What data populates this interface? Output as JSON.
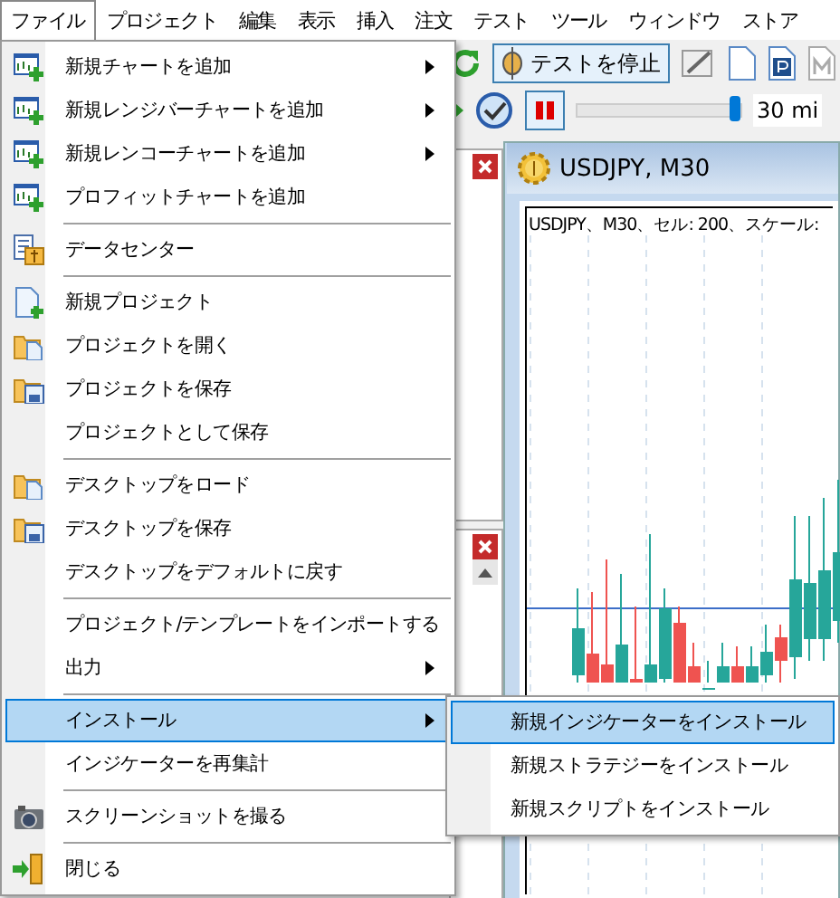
{
  "menubar": [
    {
      "label": "ファイル",
      "selected": true
    },
    {
      "label": "プロジェクト",
      "selected": false
    },
    {
      "label": "編集",
      "selected": false
    },
    {
      "label": "表示",
      "selected": false
    },
    {
      "label": "挿入",
      "selected": false
    },
    {
      "label": "注文",
      "selected": false
    },
    {
      "label": "テスト",
      "selected": false
    },
    {
      "label": "ツール",
      "selected": false
    },
    {
      "label": "ウィンドウ",
      "selected": false
    },
    {
      "label": "ストア",
      "selected": false
    }
  ],
  "toolbar": {
    "stop_test_button": "テストを停止",
    "speed_slider": {
      "level": 0.97
    },
    "speed_label": "30 mi"
  },
  "chart_window": {
    "title": "USDJPY, M30",
    "header": "USDJPY、M30、セル: 200、スケール:"
  },
  "file_menu": [
    {
      "kind": "item",
      "label": "新規チャートを追加",
      "submenu": true,
      "selected": false
    },
    {
      "kind": "item",
      "label": "新規レンジバーチャートを追加",
      "submenu": true,
      "selected": false
    },
    {
      "kind": "item",
      "label": "新規レンコーチャートを追加",
      "submenu": true,
      "selected": false
    },
    {
      "kind": "item",
      "label": "プロフィットチャートを追加",
      "submenu": false,
      "selected": false
    },
    {
      "kind": "separator"
    },
    {
      "kind": "item",
      "label": "データセンター",
      "submenu": false,
      "selected": false
    },
    {
      "kind": "separator"
    },
    {
      "kind": "item",
      "label": "新規プロジェクト",
      "submenu": false,
      "selected": false
    },
    {
      "kind": "item",
      "label": "プロジェクトを開く",
      "submenu": false,
      "selected": false
    },
    {
      "kind": "item",
      "label": "プロジェクトを保存",
      "submenu": false,
      "selected": false
    },
    {
      "kind": "item",
      "label": "プロジェクトとして保存",
      "submenu": false,
      "selected": false
    },
    {
      "kind": "separator"
    },
    {
      "kind": "item",
      "label": "デスクトップをロード",
      "submenu": false,
      "selected": false
    },
    {
      "kind": "item",
      "label": "デスクトップを保存",
      "submenu": false,
      "selected": false
    },
    {
      "kind": "item",
      "label": "デスクトップをデフォルトに戻す",
      "submenu": false,
      "selected": false
    },
    {
      "kind": "separator"
    },
    {
      "kind": "item",
      "label": "プロジェクト/テンプレートをインポートする",
      "submenu": false,
      "selected": false
    },
    {
      "kind": "item",
      "label": "出力",
      "submenu": true,
      "selected": false
    },
    {
      "kind": "separator"
    },
    {
      "kind": "item",
      "label": "インストール",
      "submenu": true,
      "selected": true
    },
    {
      "kind": "item",
      "label": "インジケーターを再集計",
      "submenu": false,
      "selected": false
    },
    {
      "kind": "separator"
    },
    {
      "kind": "item",
      "label": "スクリーンショットを撮る",
      "submenu": false,
      "selected": false
    },
    {
      "kind": "separator"
    },
    {
      "kind": "item",
      "label": "閉じる",
      "submenu": false,
      "selected": false
    }
  ],
  "install_submenu": [
    {
      "label": "新規インジケーターをインストール",
      "selected": true
    },
    {
      "label": "新規ストラテジーをインストール",
      "selected": false
    },
    {
      "label": "新規スクリプトをインストール",
      "selected": false
    }
  ]
}
